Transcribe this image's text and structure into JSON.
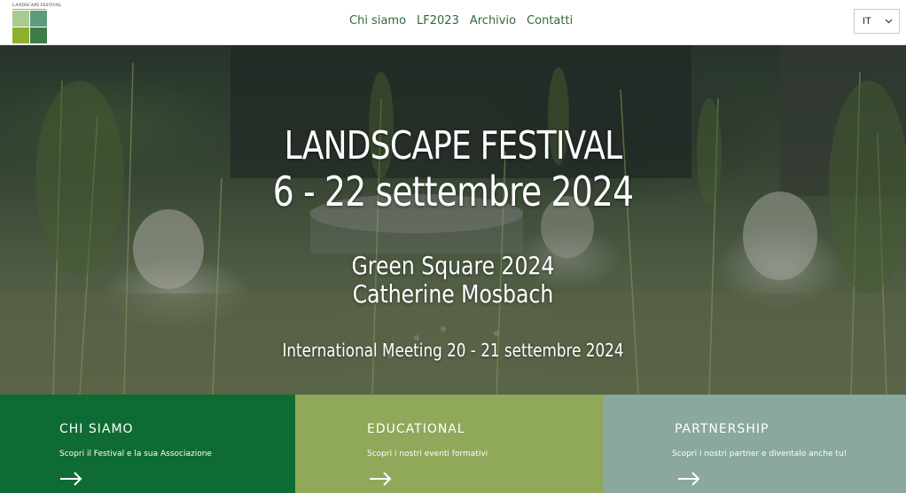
{
  "header": {
    "logo_text": "LANDSCAPE FESTIVAL",
    "nav": [
      {
        "label": "Chi siamo"
      },
      {
        "label": "LF2023"
      },
      {
        "label": "Archivio"
      },
      {
        "label": "Contatti"
      }
    ],
    "language": {
      "selected": "IT"
    }
  },
  "hero": {
    "title": "LANDSCAPE FESTIVAL",
    "dates": "6 - 22 settembre 2024",
    "line1": "Green Square 2024",
    "line2": "Catherine Mosbach",
    "meeting": "International Meeting 20 - 21 settembre 2024"
  },
  "cards": [
    {
      "title": "CHI SIAMO",
      "description": "Scopri il Festival e la sua Associazione",
      "color": "#0e6b33"
    },
    {
      "title": "EDUCATIONAL",
      "description": "Scopri i nostri eventi formativi",
      "color": "#8fa85a"
    },
    {
      "title": "PARTNERSHIP",
      "description": "Scopri i nostri partner e diventalo anche tu!",
      "color": "#8aa89c"
    }
  ],
  "colors": {
    "nav_text": "#2f6a3c",
    "logo_tl": "#a9cb8d",
    "logo_tr": "#5f9a7a",
    "logo_bl": "#8fae2b",
    "logo_br": "#3f7a49"
  },
  "icons": [
    "chevron-down-icon",
    "arrow-right-icon"
  ]
}
